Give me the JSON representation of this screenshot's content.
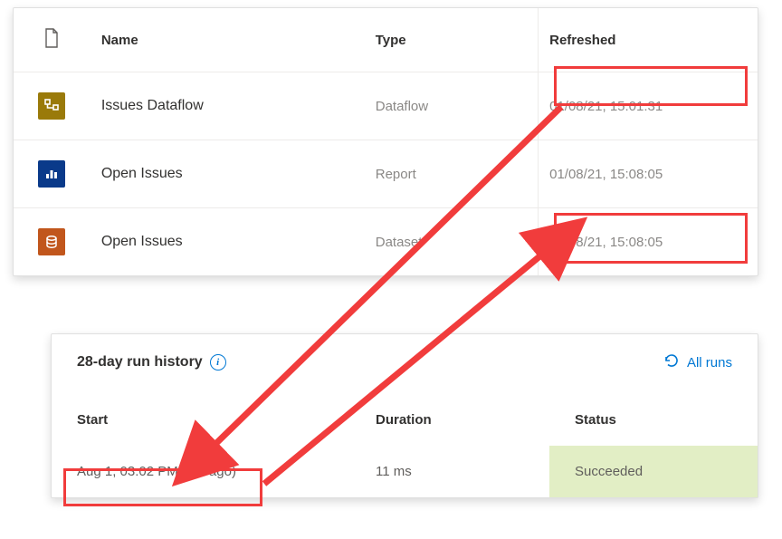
{
  "top": {
    "headers": {
      "name": "Name",
      "type": "Type",
      "refreshed": "Refreshed"
    },
    "rows": [
      {
        "name": "Issues Dataflow",
        "type": "Dataflow",
        "refreshed": "01/08/21, 15:01:31",
        "icon": "dataflow"
      },
      {
        "name": "Open Issues",
        "type": "Report",
        "refreshed": "01/08/21, 15:08:05",
        "icon": "report"
      },
      {
        "name": "Open Issues",
        "type": "Dataset",
        "refreshed": "01/08/21, 15:08:05",
        "icon": "dataset"
      }
    ]
  },
  "history": {
    "title": "28-day run history",
    "all_runs": "All runs",
    "headers": {
      "start": "Start",
      "duration": "Duration",
      "status": "Status"
    },
    "row": {
      "start": "Aug 1, 03:02 PM (3 h ago)",
      "duration": "11 ms",
      "status": "Succeeded"
    }
  },
  "colors": {
    "highlight": "#f13c3c",
    "link": "#0078d4",
    "success_bg": "#e2eec5"
  }
}
